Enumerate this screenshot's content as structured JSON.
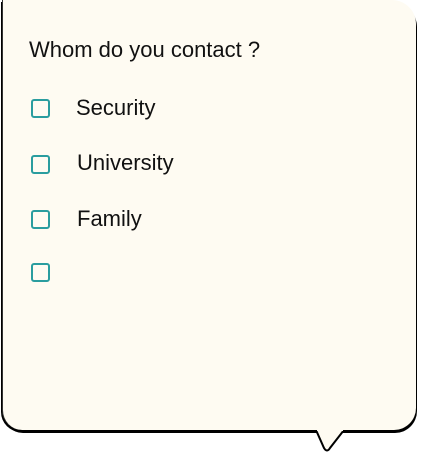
{
  "dialog": {
    "question": "Whom do you contact ?",
    "options": [
      {
        "label": " Security",
        "checked": false
      },
      {
        "label": "University",
        "checked": false
      },
      {
        "label": "Family",
        "checked": false
      },
      {
        "label": "",
        "checked": false
      }
    ]
  },
  "colors": {
    "background": "#fefbf2",
    "checkbox_border": "#2a9d9f",
    "text": "#111111"
  }
}
